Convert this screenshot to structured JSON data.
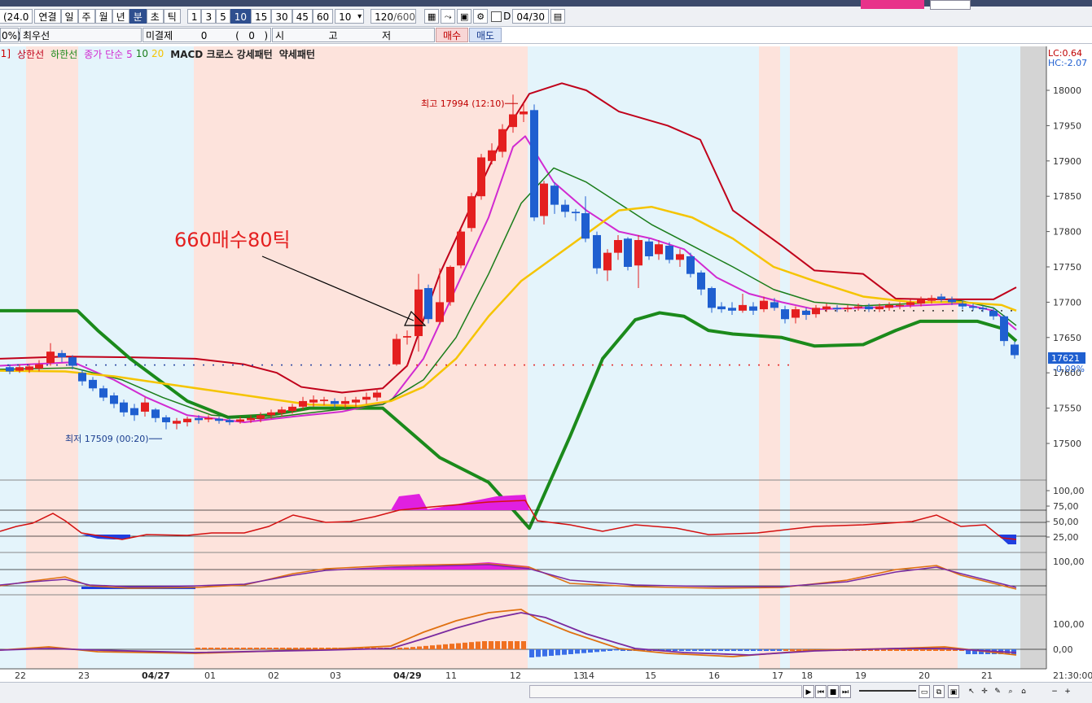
{
  "toolbar": {
    "code_partial": "(24.0",
    "period_buttons": [
      "연결",
      "일",
      "주",
      "월",
      "년",
      "분",
      "초",
      "틱"
    ],
    "selected_period": "분",
    "interval_buttons": [
      "1",
      "3",
      "5",
      "10",
      "15",
      "30",
      "45",
      "60"
    ],
    "selected_interval": "10",
    "interval_combo": "10",
    "count": "120",
    "count_total": "/600",
    "date_checkbox_label": "D",
    "date_value": "04/30"
  },
  "order_row": {
    "pct_partial": "0%)",
    "best_price_label": "최우선",
    "open_interest_label": "미결제",
    "open_interest_value": "0",
    "open_interest_change": "(   0   )",
    "ohlc_labels": [
      "시",
      "고",
      "저"
    ],
    "buy_button": "매수",
    "sell_button": "매도"
  },
  "legend": {
    "prefix": "[1]",
    "upper_band": "상한선",
    "lower_band": "하한선",
    "ma_label": "종가 단순",
    "ma_periods": [
      "5",
      "10",
      "20"
    ],
    "macd_label": "MACD 크로스",
    "strong_pattern": "강세패턴",
    "weak_pattern": "약세패턴"
  },
  "axis": {
    "lc_label": "LC:0.64",
    "hc_label": "HC:-2.07",
    "price_ticks": [
      "18000",
      "17950",
      "17900",
      "17850",
      "17800",
      "17750",
      "17700",
      "17650",
      "17600",
      "17550",
      "17500"
    ],
    "current_price": "17621",
    "current_change": "-0.09%",
    "stoch_ticks": [
      "100,00",
      "75,00",
      "50,00",
      "25,00"
    ],
    "rsi_ticks": [
      "100,00"
    ],
    "macd_ticks": [
      "100,00",
      "0,00"
    ],
    "time_labels": [
      "22",
      "23",
      "04/27",
      "01",
      "02",
      "03",
      "04/29",
      "11",
      "12",
      "13",
      "14",
      "15",
      "16",
      "17",
      "18",
      "19",
      "20",
      "21"
    ],
    "end_time": "21:30:00"
  },
  "annotations": {
    "high_label": "최고 17994 (12:10)",
    "low_label": "최저 17509 (00:20)",
    "note_text": "660매수80틱"
  },
  "colors": {
    "bull": "#e41f1f",
    "bear": "#1f5fd0",
    "bg_red": "#fde3dc",
    "bg_blue": "#e4f4fb",
    "upper_band": "#c0001a",
    "lower_band": "#1b8a1b",
    "ma5": "#d12ad1",
    "ma10": "#1a7d1a",
    "ma20": "#f5c400"
  },
  "chart_data": {
    "type": "candlestick",
    "price_range": [
      17430,
      18050
    ],
    "high": 17994,
    "low": 17509,
    "last": 17621
  }
}
